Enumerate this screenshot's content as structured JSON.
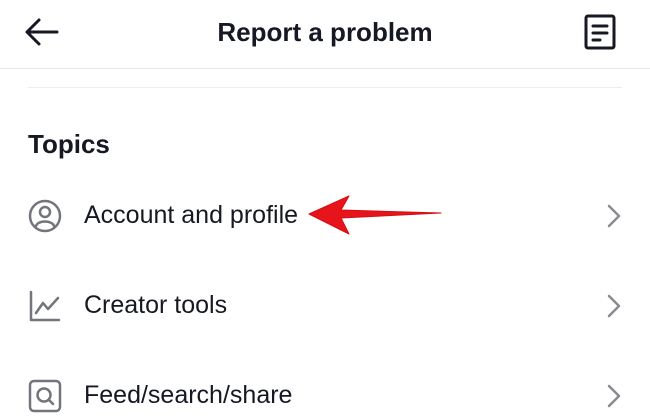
{
  "header": {
    "title": "Report a problem",
    "back_icon": "arrow-left-icon",
    "history_icon": "document-list-icon"
  },
  "topics": {
    "heading": "Topics",
    "items": [
      {
        "label": "Account and profile",
        "icon": "user-circle-icon"
      },
      {
        "label": "Creator tools",
        "icon": "line-chart-icon"
      },
      {
        "label": "Feed/search/share",
        "icon": "search-square-icon"
      }
    ]
  },
  "annotation": {
    "color": "#e8141b",
    "icon": "red-arrow-pointer"
  },
  "colors": {
    "text": "#161823",
    "icon_gray": "#73757c",
    "chevron_gray": "#8a8b91",
    "divider": "#ececee"
  }
}
